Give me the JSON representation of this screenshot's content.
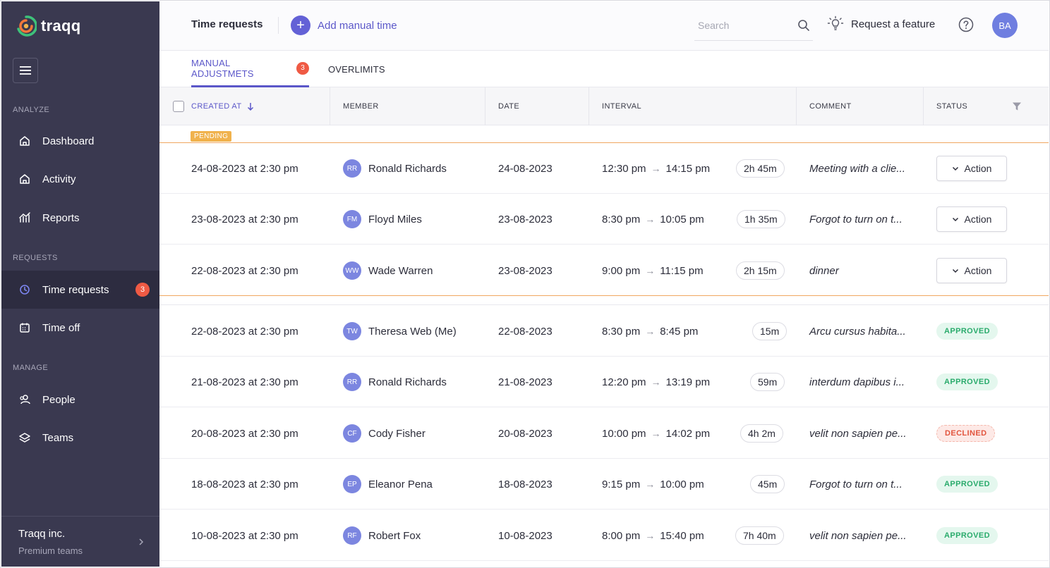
{
  "app": {
    "name": "traqq",
    "colors": {
      "sidebar": "#3a3950",
      "accent": "#5b57c9",
      "badge": "#ef5a44",
      "pending": "#f0b24d"
    }
  },
  "sidebar": {
    "sections": {
      "analyze": "ANALYZE",
      "requests": "REQUESTS",
      "manage": "MANAGE"
    },
    "items": {
      "dashboard": "Dashboard",
      "activity": "Activity",
      "reports": "Reports",
      "time_requests": "Time requests",
      "time_requests_badge": "3",
      "time_off": "Time off",
      "people": "People",
      "teams": "Teams"
    },
    "org": {
      "name": "Traqq inc.",
      "plan": "Premium teams"
    }
  },
  "header": {
    "title": "Time requests",
    "add_label": "Add manual time",
    "search_placeholder": "Search",
    "feature_label": "Request a feature",
    "avatar_initials": "BA"
  },
  "tabs": {
    "manual": "MANUAL ADJUSTMETS",
    "manual_badge": "3",
    "overlimits": "OVERLIMITS"
  },
  "table": {
    "columns": {
      "created_at": "CREATED AT",
      "member": "MEMBER",
      "date": "DATE",
      "interval": "INTERVAL",
      "comment": "COMMENT",
      "status": "STATUS"
    },
    "pending_label": "PENDING",
    "action_label": "Action",
    "rows": [
      {
        "created": "24-08-2023 at 2:30 pm",
        "initials": "RR",
        "member": "Ronald Richards",
        "date": "24-08-2023",
        "start": "12:30 pm",
        "end": "14:15 pm",
        "duration": "2h 45m",
        "comment": "Meeting with a clie...",
        "status": ""
      },
      {
        "created": "23-08-2023 at 2:30 pm",
        "initials": "FM",
        "member": "Floyd Miles",
        "date": "23-08-2023",
        "start": "8:30 pm",
        "end": "10:05 pm",
        "duration": "1h 35m",
        "comment": "Forgot to turn on t...",
        "status": ""
      },
      {
        "created": "22-08-2023 at 2:30 pm",
        "initials": "WW",
        "member": "Wade Warren",
        "date": "23-08-2023",
        "start": "9:00 pm",
        "end": "11:15 pm",
        "duration": "2h 15m",
        "comment": "dinner",
        "status": ""
      },
      {
        "created": "22-08-2023 at 2:30 pm",
        "initials": "TW",
        "member": "Theresa Web (Me)",
        "date": "22-08-2023",
        "start": "8:30 pm",
        "end": "8:45 pm",
        "duration": "15m",
        "comment": "Arcu cursus habita...",
        "status": "APPROVED"
      },
      {
        "created": "21-08-2023 at 2:30 pm",
        "initials": "RR",
        "member": "Ronald Richards",
        "date": "21-08-2023",
        "start": "12:20 pm",
        "end": "13:19 pm",
        "duration": "59m",
        "comment": "interdum dapibus i...",
        "status": "APPROVED"
      },
      {
        "created": "20-08-2023 at 2:30 pm",
        "initials": "CF",
        "member": "Cody Fisher",
        "date": "20-08-2023",
        "start": "10:00 pm",
        "end": "14:02 pm",
        "duration": "4h 2m",
        "comment": "velit non sapien pe...",
        "status": "DECLINED"
      },
      {
        "created": "18-08-2023 at 2:30 pm",
        "initials": "EP",
        "member": "Eleanor Pena",
        "date": "18-08-2023",
        "start": "9:15 pm",
        "end": "10:00 pm",
        "duration": "45m",
        "comment": "Forgot to turn on t...",
        "status": "APPROVED"
      },
      {
        "created": "10-08-2023 at 2:30 pm",
        "initials": "RF",
        "member": "Robert Fox",
        "date": "10-08-2023",
        "start": "8:00 pm",
        "end": "15:40 pm",
        "duration": "7h 40m",
        "comment": "velit non sapien pe...",
        "status": "APPROVED"
      }
    ]
  }
}
